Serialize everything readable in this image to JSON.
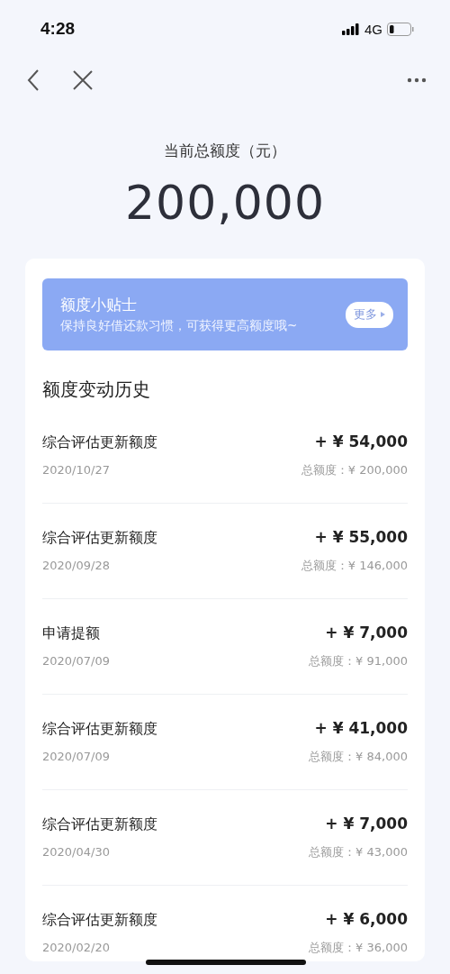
{
  "status_bar": {
    "time": "4:28",
    "network": "4G"
  },
  "header": {
    "title": "当前总额度（元）",
    "amount": "200,000"
  },
  "tip_banner": {
    "title": "额度小贴士",
    "text": "保持良好借还款习惯，可获得更高额度哦~",
    "button": "更多"
  },
  "history": {
    "title": "额度变动历史",
    "rows": [
      {
        "name": "综合评估更新额度",
        "change": "+ ¥ 54,000",
        "date": "2020/10/27",
        "total": "总额度：¥ 200,000"
      },
      {
        "name": "综合评估更新额度",
        "change": "+ ¥ 55,000",
        "date": "2020/09/28",
        "total": "总额度：¥ 146,000"
      },
      {
        "name": "申请提额",
        "change": "+ ¥ 7,000",
        "date": "2020/07/09",
        "total": "总额度：¥ 91,000"
      },
      {
        "name": "综合评估更新额度",
        "change": "+ ¥ 41,000",
        "date": "2020/07/09",
        "total": "总额度：¥ 84,000"
      },
      {
        "name": "综合评估更新额度",
        "change": "+ ¥ 7,000",
        "date": "2020/04/30",
        "total": "总额度：¥ 43,000"
      },
      {
        "name": "综合评估更新额度",
        "change": "+ ¥ 6,000",
        "date": "2020/02/20",
        "total": "总额度：¥ 36,000"
      }
    ]
  }
}
